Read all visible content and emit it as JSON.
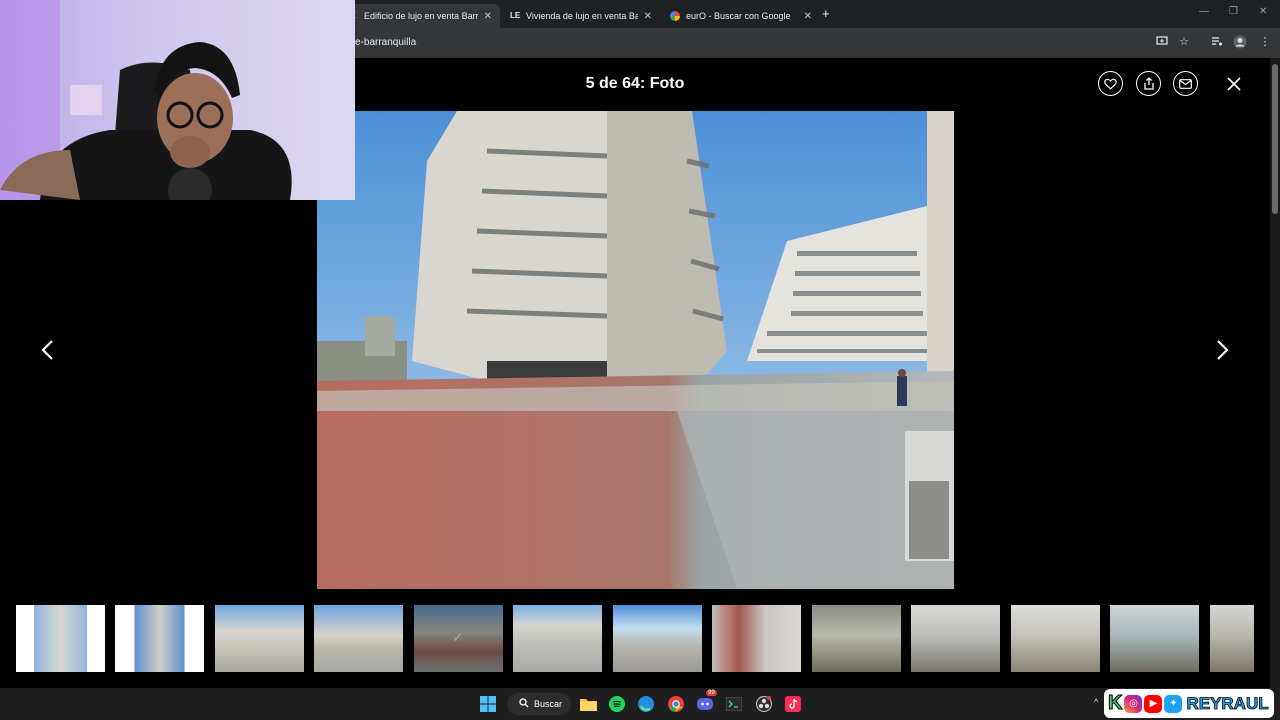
{
  "browser": {
    "tabs": [
      {
        "title": "Edificio de lujo en venta Barranquilla",
        "favicon": "E",
        "active": true
      },
      {
        "title": "Vivienda de lujo en venta Barranquilla",
        "favicon": "LE",
        "active": false
      },
      {
        "title": "eurO - Buscar con Google",
        "favicon": "G",
        "active": false
      }
    ],
    "url": "e-barranquilla"
  },
  "gallery": {
    "counter": "5 de 64: Foto",
    "actions": [
      "heart-icon",
      "share-icon",
      "email-icon"
    ],
    "thumbnail_count": 13,
    "selected_thumbnail": 5
  },
  "taskbar": {
    "search_label": "Buscar",
    "apps": [
      "start-icon",
      "search-icon",
      "file-explorer-icon",
      "spotify-icon",
      "edge-icon",
      "chrome-icon",
      "discord-icon",
      "terminal-icon",
      "obs-icon",
      "tiktok-icon"
    ],
    "discord_badge": "99"
  },
  "overlay": {
    "brand_letter": "K",
    "brand_name": "REYRAUL"
  }
}
